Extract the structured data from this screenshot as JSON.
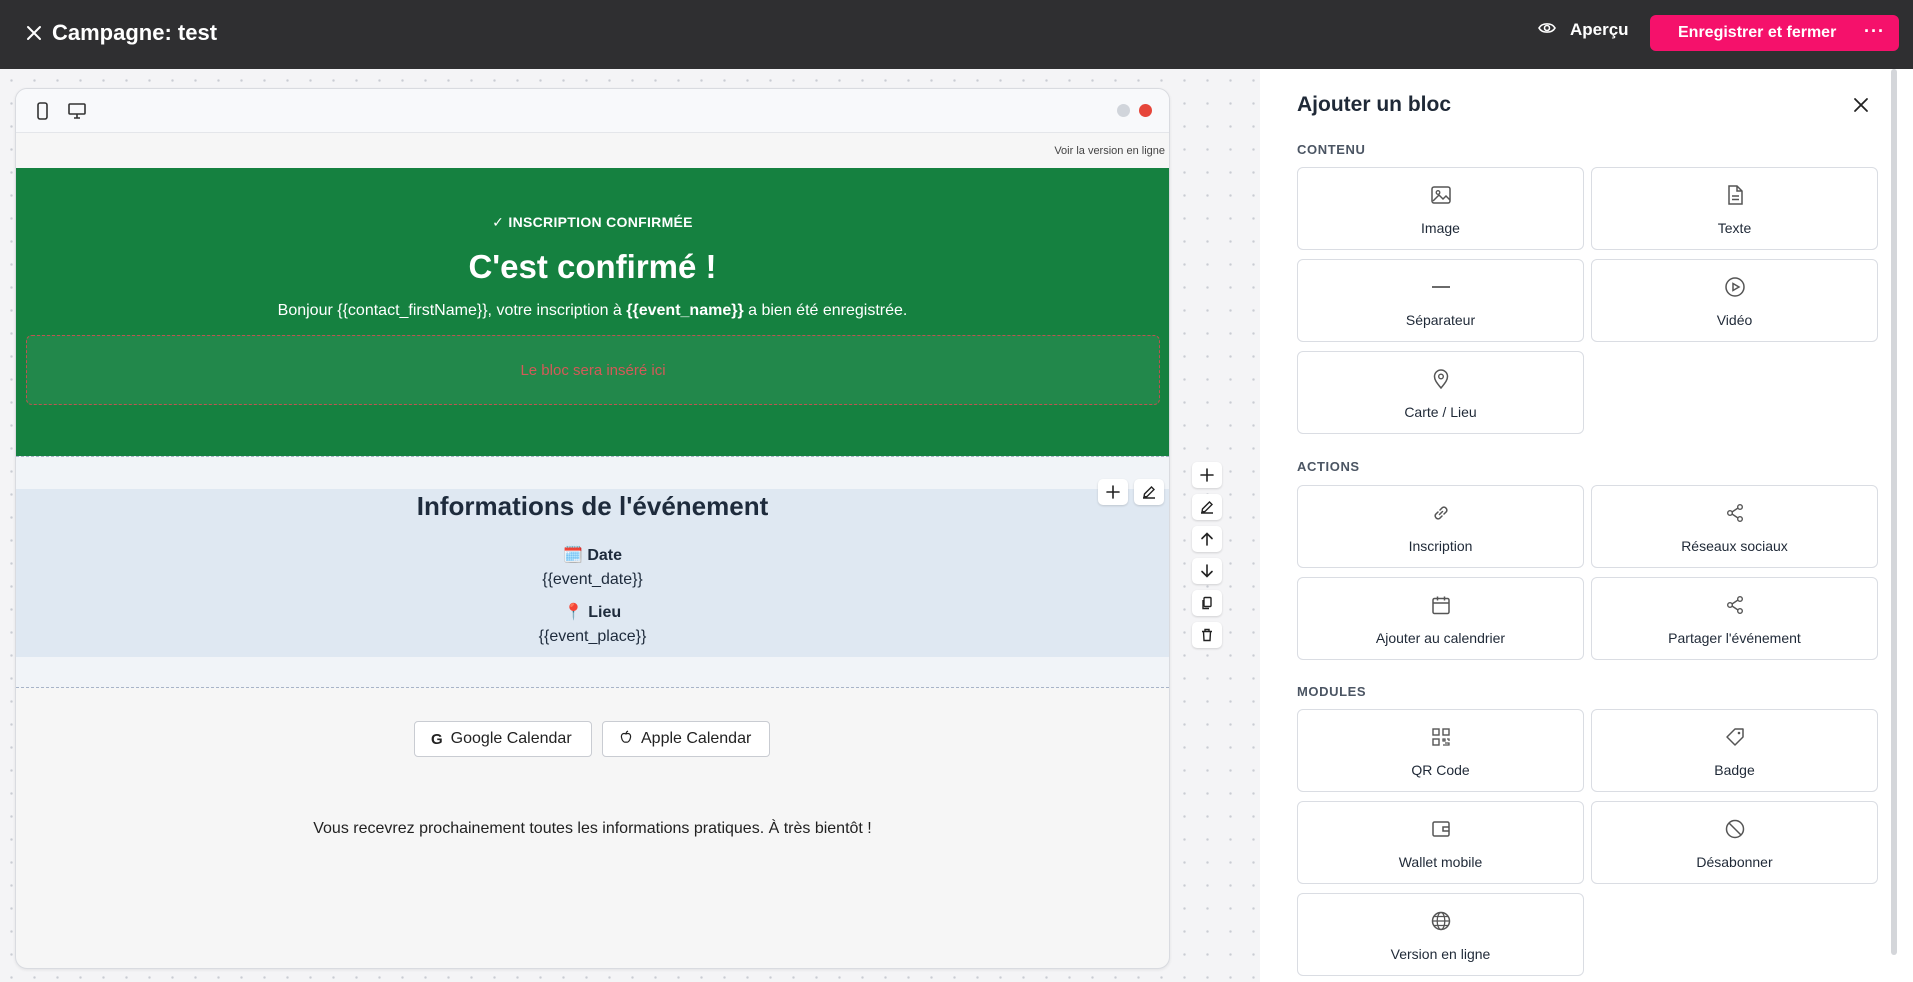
{
  "header": {
    "title": "Campagne: test",
    "preview_label": "Aperçu",
    "save_label": "Enregistrer et fermer",
    "more_label": "···"
  },
  "email": {
    "online_link": "Voir la version en ligne",
    "hero": {
      "kicker": "✓ INSCRIPTION CONFIRMÉE",
      "headline": "C'est confirmé !",
      "greet_prefix": "Bonjour {{contact_firstName}}, votre inscription à ",
      "greet_event": "{{event_name}}",
      "greet_suffix": " a bien été enregistrée.",
      "drop_zone": "Le bloc sera inséré ici"
    },
    "info": {
      "title": "Informations de l'événement",
      "date_label": "🗓️ Date",
      "date_value": "{{event_date}}",
      "place_label": "📍 Lieu",
      "place_value": "{{event_place}}"
    },
    "calendar_buttons": {
      "google": "Google Calendar",
      "apple": "Apple Calendar"
    },
    "footer": "Vous recevrez prochainement toutes les informations pratiques. À très bientôt !"
  },
  "panel": {
    "title": "Ajouter un bloc",
    "sections": {
      "content": "CONTENU",
      "actions": "ACTIONS",
      "modules": "MODULES"
    },
    "blocks": {
      "image": "Image",
      "text": "Texte",
      "separator": "Séparateur",
      "video": "Vidéo",
      "map": "Carte / Lieu",
      "registration": "Inscription",
      "social": "Réseaux sociaux",
      "add_calendar": "Ajouter au calendrier",
      "share_event": "Partager l'événement",
      "qr_code": "QR Code",
      "badge": "Badge",
      "wallet": "Wallet mobile",
      "unsubscribe": "Désabonner",
      "online_version": "Version en ligne"
    }
  },
  "colors": {
    "topbar": "#2f2f31",
    "accent": "#f5116b",
    "hero_green": "#158140",
    "info_bg": "#dfe8f2"
  }
}
